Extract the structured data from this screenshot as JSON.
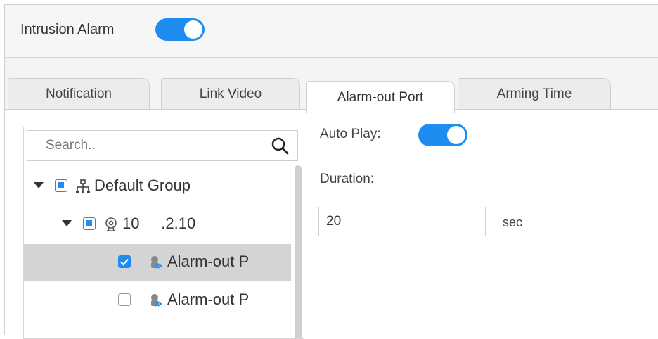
{
  "header": {
    "title": "Intrusion Alarm",
    "toggle_on": true
  },
  "tabs": [
    {
      "label": "Notification",
      "active": false
    },
    {
      "label": "Link Video",
      "active": false
    },
    {
      "label": "Alarm-out Port",
      "active": true
    },
    {
      "label": "Arming Time",
      "active": false
    }
  ],
  "tree": {
    "search_placeholder": "Search..",
    "rows": [
      {
        "label": "Default Group",
        "icon": "group-icon",
        "state": "partial",
        "expanded": true
      },
      {
        "label": "10       .2.10",
        "icon": "camera-icon",
        "state": "partial",
        "expanded": true
      },
      {
        "label": "Alarm-out P",
        "icon": "alarm-out-port-icon",
        "state": "checked",
        "selected": true
      },
      {
        "label": "Alarm-out P",
        "icon": "alarm-out-port-icon",
        "state": "unchecked",
        "selected": false
      }
    ]
  },
  "settings": {
    "auto_play_label": "Auto Play:",
    "auto_play_on": true,
    "duration_label": "Duration:",
    "duration_value": "20",
    "duration_unit": "sec"
  },
  "colors": {
    "accent": "#1f8df0",
    "selected_row": "#d4d4d4"
  }
}
